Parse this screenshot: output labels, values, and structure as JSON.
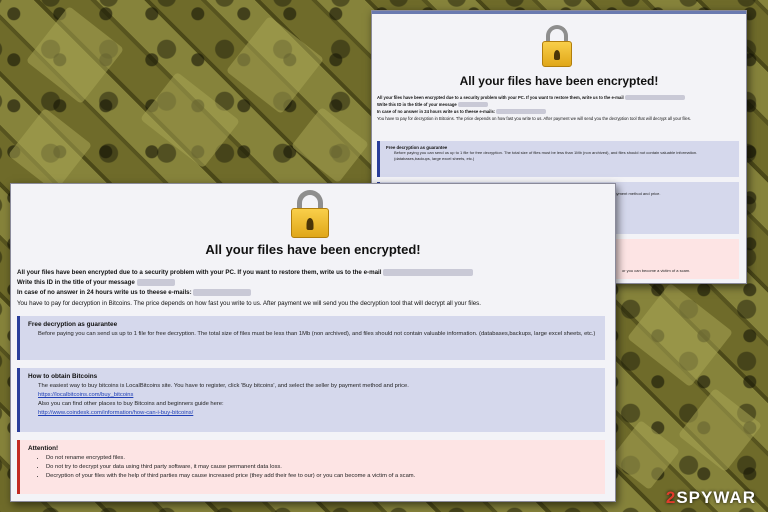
{
  "watermark": {
    "prefix": "2",
    "text": "SPYWAR"
  },
  "back_window": {
    "headline": "All your files have been encrypted!",
    "line1": "All your files have been encrypted due to a security problem with your PC. If you want to restore them, write us to the e-mail",
    "line2": "Write this ID in the title of your message",
    "line3": "In case of no answer in 24 hours write us to theese e-mails:",
    "line4": "You have to pay for decryption in Bitcoins. The price depends on how fast you write to us. After payment we will send you the decryption tool that will decrypt all your files.",
    "box1_title": "Free decryption as guarantee",
    "box1_text": "Before paying you can send us up to 1 file for free decryption. The total size of files must be less than 1Mb (non archived), and files should not contain valuable information. (databases,backups, large excel sheets, etc.)",
    "box2_title": "How to obtain Bitcoins",
    "box2_text": "seller by payment method and price.",
    "box3_text": "or you can become a victim of a scam."
  },
  "front_window": {
    "headline": "All your files have been encrypted!",
    "line1": "All your files have been encrypted due to a security problem with your PC. If you want to restore them, write us to the e-mail",
    "line2": "Write this ID in the title of your message",
    "line3": "In case of no answer in 24 hours write us to theese e-mails:",
    "line4": "You have to pay for decryption in Bitcoins. The price depends on how fast you write to us. After payment we will send you the decryption tool that will decrypt all your files.",
    "box1_title": "Free decryption as guarantee",
    "box1_text": "Before paying you can send us up to 1 file for free decryption. The total size of files must be less than 1Mb (non archived), and files should not contain valuable information. (databases,backups, large excel sheets, etc.)",
    "box2_title": "How to obtain Bitcoins",
    "box2_text1": "The easiest way to buy bitcoins is LocalBitcoins site. You have to register, click 'Buy bitcoins', and select the seller by payment method and price.",
    "box2_link1": "https://localbitcoins.com/buy_bitcoins",
    "box2_text2": "Also you can find other places to buy Bitcoins and beginners guide here:",
    "box2_link2": "http://www.coindesk.com/information/how-can-i-buy-bitcoins/",
    "box3_title": "Attention!",
    "box3_items": [
      "Do not rename encrypted files.",
      "Do not try to decrypt your data using third party software, it may cause permanent data loss.",
      "Decryption of your files with the help of third parties may cause increased price (they add their fee to our) or you can become a victim of a scam."
    ]
  },
  "colors": {
    "blue_box": "#d5d8ec",
    "blue_accent": "#2a3e9a",
    "red_box": "#fde4e4",
    "red_accent": "#c22a22",
    "link": "#1f3fb5"
  },
  "icons": {
    "lock": "padlock-icon"
  }
}
